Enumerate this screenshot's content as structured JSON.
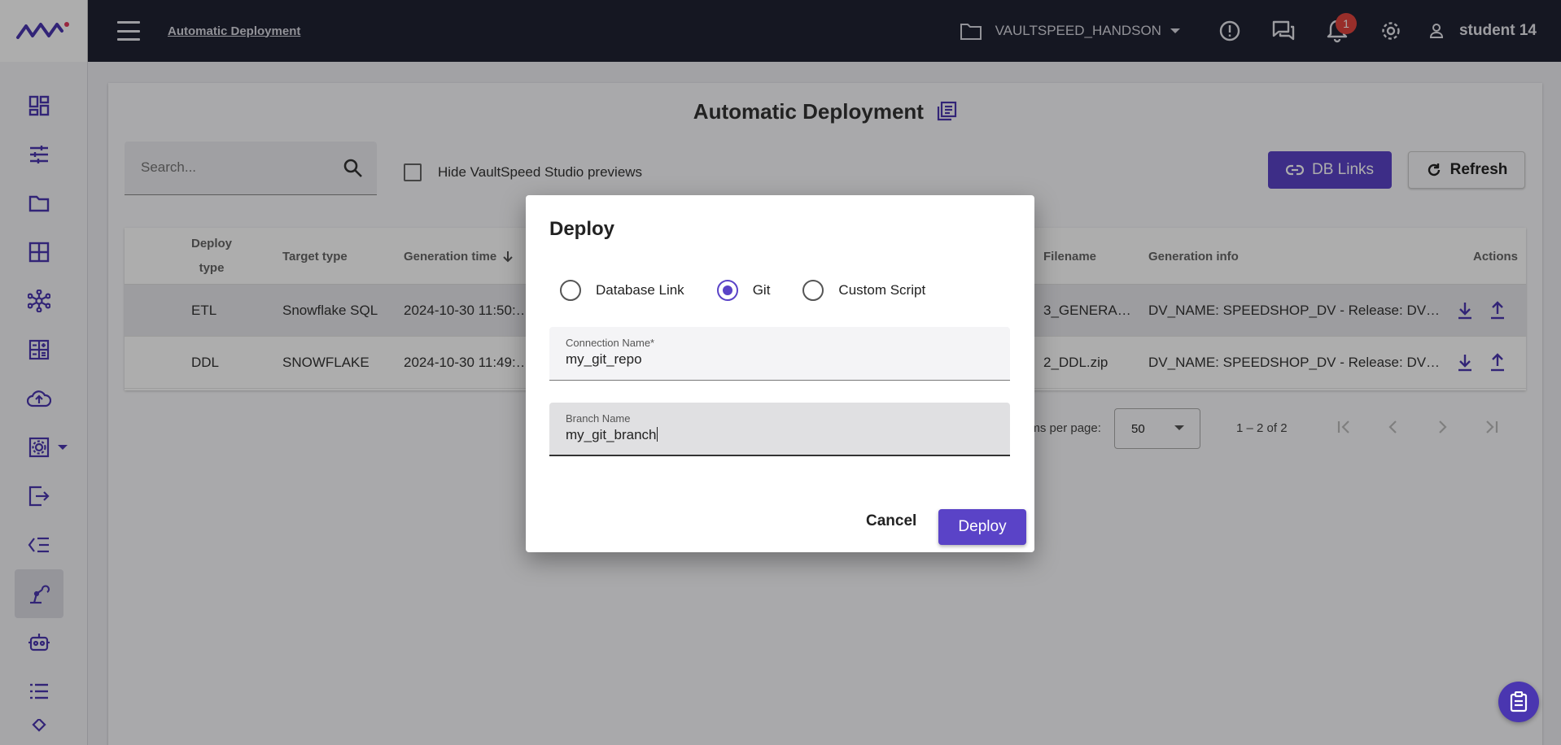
{
  "header": {
    "breadcrumb": "Automatic Deployment",
    "project": "VAULTSPEED_HANDSON",
    "notification_count": "1",
    "user": "student 14"
  },
  "sidebar": {
    "items": [
      "dashboard-icon",
      "tune-icon",
      "folder-icon",
      "grid-icon",
      "hub-icon",
      "calculator-icon",
      "cloud-upload-icon",
      "settings-box-icon",
      "export-icon",
      "list-check-icon",
      "deploy-robot-icon",
      "robot-icon",
      "list-icon",
      "diamond-icon"
    ]
  },
  "page": {
    "title": "Automatic Deployment",
    "search_placeholder": "Search...",
    "hide_previews_label": "Hide VaultSpeed Studio previews",
    "db_links_label": "DB Links",
    "refresh_label": "Refresh"
  },
  "table": {
    "headers": {
      "deploy_type_1": "Deploy",
      "deploy_type_2": "type",
      "target_type": "Target type",
      "generation_time": "Generation time",
      "filename": "Filename",
      "generation_info": "Generation info",
      "actions": "Actions"
    },
    "rows": [
      {
        "deploy_type": "ETL",
        "target_type": "Snowflake SQL",
        "generation_time": "2024-10-30 11:50:…",
        "filename": "3_GENERA…",
        "generation_info": "DV_NAME: SPEEDSHOP_DV - Release: DV…"
      },
      {
        "deploy_type": "DDL",
        "target_type": "SNOWFLAKE",
        "generation_time": "2024-10-30 11:49:…",
        "filename": "2_DDL.zip",
        "generation_info": "DV_NAME: SPEEDSHOP_DV - Release: DV…"
      }
    ]
  },
  "pagination": {
    "items_per_page_label": "ems per page:",
    "items_per_page": "50",
    "range": "1 – 2 of 2"
  },
  "dialog": {
    "title": "Deploy",
    "options": [
      "Database Link",
      "Git",
      "Custom Script"
    ],
    "selected": "Git",
    "connection_label": "Connection Name*",
    "connection_value": "my_git_repo",
    "branch_label": "Branch Name",
    "branch_value": "my_git_branch",
    "cancel": "Cancel",
    "deploy": "Deploy"
  },
  "colors": {
    "accent": "#5a43c7",
    "topbar": "#1f2233",
    "badge": "#e0443e"
  }
}
